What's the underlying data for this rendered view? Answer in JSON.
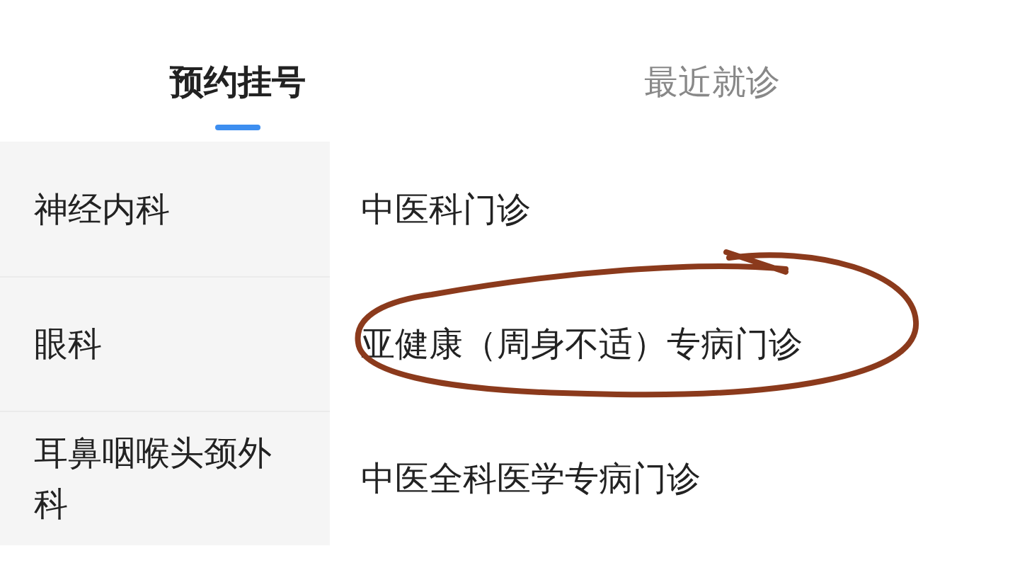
{
  "tabs": [
    {
      "label": "预约挂号",
      "selected": true
    },
    {
      "label": "最近就诊",
      "selected": false
    }
  ],
  "departments": [
    {
      "label": "神经内科"
    },
    {
      "label": "眼科"
    },
    {
      "label": "耳鼻咽喉头颈外科"
    }
  ],
  "clinics": [
    {
      "label": "中医科门诊"
    },
    {
      "label": "亚健康（周身不适）专病门诊"
    },
    {
      "label": "中医全科医学专病门诊"
    }
  ]
}
